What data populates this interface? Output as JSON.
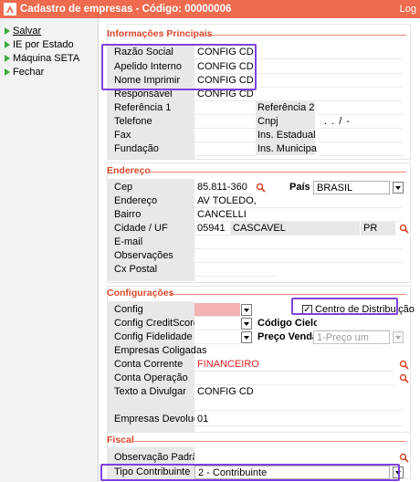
{
  "window": {
    "title": "Cadastro de empresas - Código: 00000006",
    "log_label": "Log"
  },
  "sidebar": {
    "items": [
      {
        "label": "Salvar",
        "icon": "play-icon"
      },
      {
        "label": "IE por Estado",
        "icon": "play-icon"
      },
      {
        "label": "Máquina SETA",
        "icon": "play-icon"
      },
      {
        "label": "Fechar",
        "icon": "play-icon"
      }
    ]
  },
  "info": {
    "title": "Informações Principais",
    "razao_social_label": "Razão Social",
    "razao_social": "CONFIG CD",
    "apelido_label": "Apelido Interno",
    "apelido": "CONFIG CD",
    "nome_imprimir_label": "Nome Imprimir",
    "nome_imprimir": "CONFIG CD",
    "responsavel_label": "Responsável",
    "responsavel": "CONFIG CD",
    "referencia1_label": "Referência 1",
    "referencia1": "",
    "referencia2_label": "Referência 2",
    "referencia2": "",
    "telefone_label": "Telefone",
    "telefone": "",
    "cnpj_label": "Cnpj",
    "cnpj": ". . /  -",
    "fax_label": "Fax",
    "fax": "",
    "ins_estadual_label": "Ins. Estadual",
    "ins_estadual": "",
    "fundacao_label": "Fundação",
    "fundacao": "",
    "ins_municipal_label": "Ins. Municipal",
    "ins_municipal": ""
  },
  "endereco": {
    "title": "Endereço",
    "cep_label": "Cep",
    "cep": "85.811-360",
    "pais_label": "País",
    "pais": "BRASIL",
    "endereco_label": "Endereço",
    "endereco": "AV TOLEDO,",
    "bairro_label": "Bairro",
    "bairro": "CANCELLI",
    "cidade_label": "Cidade / UF",
    "cidade_code": "05941",
    "cidade": "CASCAVEL",
    "uf": "PR",
    "email_label": "E-mail",
    "email": "",
    "observacoes_label": "Observações",
    "observacoes": "",
    "cx_postal_label": "Cx Postal",
    "cx_postal": ""
  },
  "configuracoes": {
    "title": "Configurações",
    "config_label": "Config",
    "config": "",
    "centro_label": "Centro de Distribuição",
    "centro_checked": true,
    "creditscore_label": "Config CreditScore",
    "creditscore": "",
    "codigo_cielo_label": "Código Cielo",
    "codigo_cielo": "",
    "fidelidade_label": "Config Fidelidade",
    "fidelidade": "",
    "preco_venda_label": "Preço Venda",
    "preco_venda": "1-Preço um",
    "coligadas_label": "Empresas Coligadas",
    "conta_corrente_label": "Conta Corrente",
    "conta_corrente": "FINANCEIRO",
    "conta_operacao_label": "Conta Operação",
    "conta_operacao": "",
    "texto_label": "Texto a Divulgar",
    "texto": "CONFIG CD",
    "devolucoes_label": "Empresas Devoluções",
    "devolucoes": "01"
  },
  "fiscal": {
    "title": "Fiscal",
    "obs_padrao_label": "Observação Padrão",
    "obs_padrao": "",
    "tipo_contribuinte_label": "Tipo Contribuinte",
    "tipo_contribuinte": "2 - Contribuinte"
  },
  "colors": {
    "accent": "#ee6b4f",
    "section_title": "#d9482b",
    "highlight": "#7e42d8",
    "link_red": "#e01f1f"
  }
}
